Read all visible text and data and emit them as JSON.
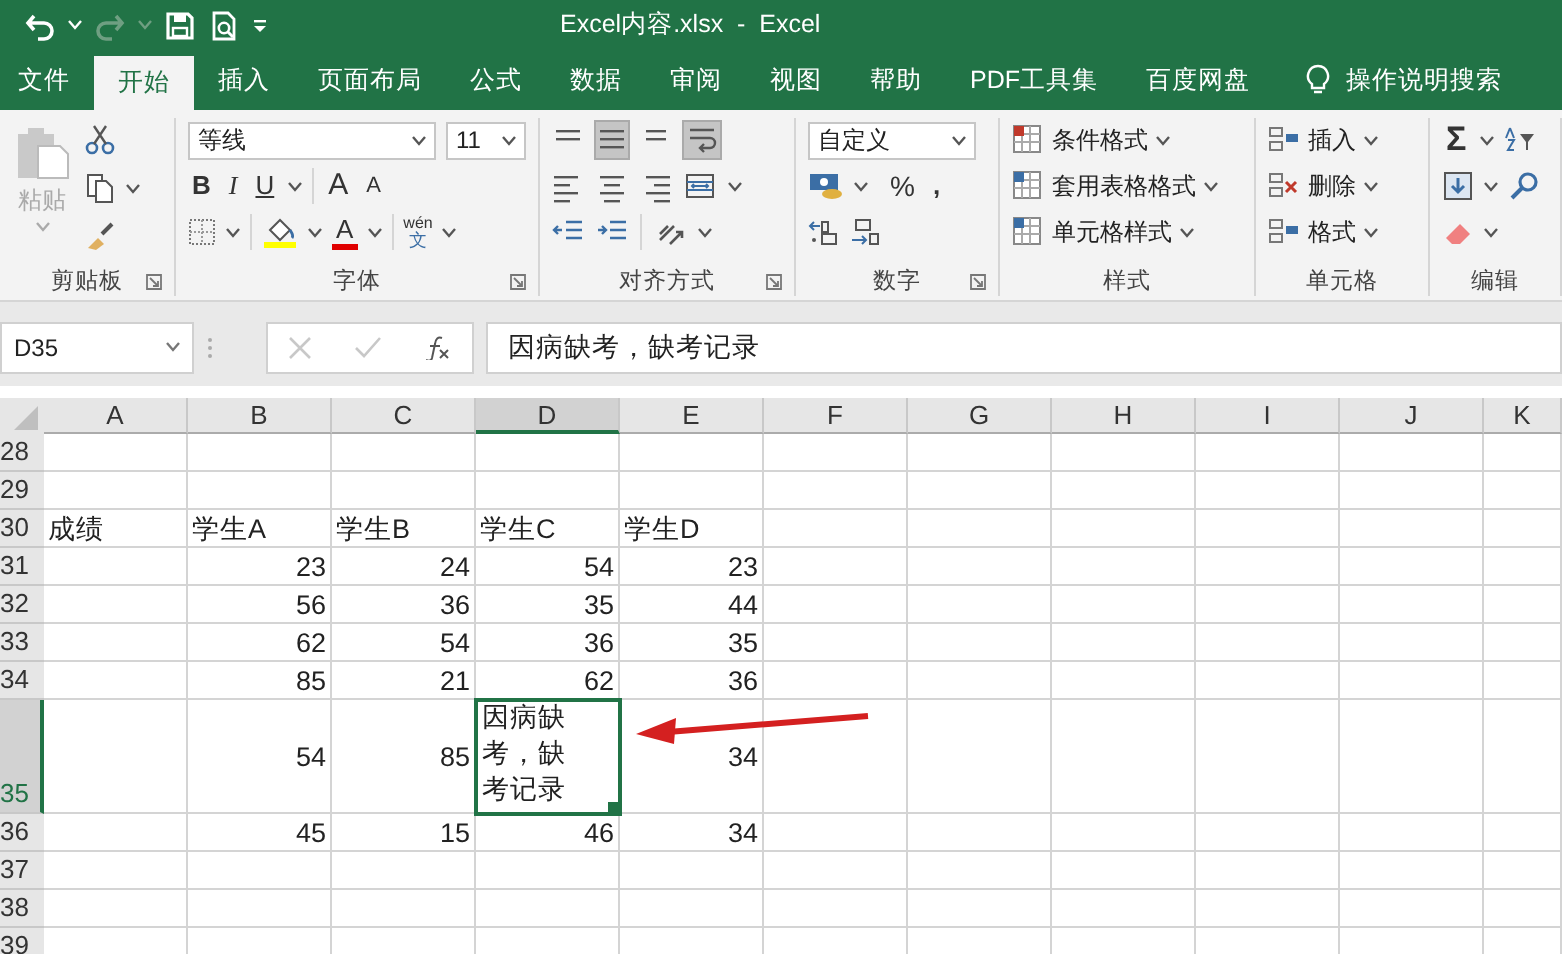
{
  "title_bar": {
    "title": "Excel内容.xlsx  -  Excel",
    "redo_disabled": true
  },
  "tabs": [
    {
      "label": "文件",
      "selected": false,
      "kind": "tab"
    },
    {
      "label": "开始",
      "selected": true,
      "kind": "tab"
    },
    {
      "label": "插入",
      "selected": false,
      "kind": "tab"
    },
    {
      "label": "页面布局",
      "selected": false,
      "kind": "tab"
    },
    {
      "label": "公式",
      "selected": false,
      "kind": "tab"
    },
    {
      "label": "数据",
      "selected": false,
      "kind": "tab"
    },
    {
      "label": "审阅",
      "selected": false,
      "kind": "tab"
    },
    {
      "label": "视图",
      "selected": false,
      "kind": "tab"
    },
    {
      "label": "帮助",
      "selected": false,
      "kind": "tab"
    },
    {
      "label": "PDF工具集",
      "selected": false,
      "kind": "tab"
    },
    {
      "label": "百度网盘",
      "selected": false,
      "kind": "tab"
    },
    {
      "label": "操作说明搜索",
      "selected": false,
      "kind": "search"
    }
  ],
  "ribbon": {
    "clipboard": {
      "paste_label": "粘贴",
      "paste_disabled": true,
      "group_label": "剪贴板"
    },
    "font": {
      "font_name": "等线",
      "font_size": "11",
      "bold": "B",
      "italic": "I",
      "underline": "U",
      "grow": "A",
      "shrink": "A",
      "font_color": "A",
      "phonetic_top": "wén",
      "phonetic_bottom": "文",
      "group_label": "字体"
    },
    "alignment": {
      "middle_align_on": true,
      "wrap_text_on": true,
      "group_label": "对齐方式"
    },
    "number": {
      "format": "自定义",
      "percent": "%",
      "comma": ",",
      "group_label": "数字"
    },
    "styles": {
      "items": [
        "条件格式",
        "套用表格格式",
        "单元格样式"
      ],
      "group_label": "样式"
    },
    "cells": {
      "items": [
        "插入",
        "删除",
        "格式"
      ],
      "group_label": "单元格"
    },
    "editing": {
      "sum": "Σ",
      "group_label": "编辑"
    }
  },
  "formula_bar": {
    "name_box": "D35",
    "content": "因病缺考，缺考记录"
  },
  "sheet": {
    "columns": [
      {
        "label": "A",
        "selected": false
      },
      {
        "label": "B",
        "selected": false
      },
      {
        "label": "C",
        "selected": false
      },
      {
        "label": "D",
        "selected": true
      },
      {
        "label": "E",
        "selected": false
      },
      {
        "label": "F",
        "selected": false
      },
      {
        "label": "G",
        "selected": false
      },
      {
        "label": "H",
        "selected": false
      },
      {
        "label": "I",
        "selected": false
      },
      {
        "label": "J",
        "selected": false
      },
      {
        "label": "K",
        "selected": false
      }
    ],
    "rows": [
      {
        "label": "28",
        "selected": false,
        "tall": false,
        "cells": []
      },
      {
        "label": "29",
        "selected": false,
        "tall": false,
        "cells": []
      },
      {
        "label": "30",
        "selected": false,
        "tall": false,
        "cells": [
          {
            "kind": "text",
            "text": "成绩",
            "active": false
          },
          {
            "kind": "text",
            "text": "学生A",
            "active": false
          },
          {
            "kind": "text",
            "text": "学生B",
            "active": false
          },
          {
            "kind": "text",
            "text": "学生C",
            "active": false
          },
          {
            "kind": "text",
            "text": "学生D",
            "active": false
          }
        ]
      },
      {
        "label": "31",
        "selected": false,
        "tall": false,
        "cells": [
          null,
          {
            "kind": "number",
            "text": "23",
            "active": false
          },
          {
            "kind": "number",
            "text": "24",
            "active": false
          },
          {
            "kind": "number",
            "text": "54",
            "active": false
          },
          {
            "kind": "number",
            "text": "23",
            "active": false
          }
        ]
      },
      {
        "label": "32",
        "selected": false,
        "tall": false,
        "cells": [
          null,
          {
            "kind": "number",
            "text": "56",
            "active": false
          },
          {
            "kind": "number",
            "text": "36",
            "active": false
          },
          {
            "kind": "number",
            "text": "35",
            "active": false
          },
          {
            "kind": "number",
            "text": "44",
            "active": false
          }
        ]
      },
      {
        "label": "33",
        "selected": false,
        "tall": false,
        "cells": [
          null,
          {
            "kind": "number",
            "text": "62",
            "active": false
          },
          {
            "kind": "number",
            "text": "54",
            "active": false
          },
          {
            "kind": "number",
            "text": "36",
            "active": false
          },
          {
            "kind": "number",
            "text": "35",
            "active": false
          }
        ]
      },
      {
        "label": "34",
        "selected": false,
        "tall": false,
        "cells": [
          null,
          {
            "kind": "number",
            "text": "85",
            "active": false
          },
          {
            "kind": "number",
            "text": "21",
            "active": false
          },
          {
            "kind": "number",
            "text": "62",
            "active": false
          },
          {
            "kind": "number",
            "text": "36",
            "active": false
          }
        ]
      },
      {
        "label": "35",
        "selected": true,
        "tall": true,
        "cells": [
          null,
          {
            "kind": "number",
            "text": "54",
            "active": false
          },
          {
            "kind": "number",
            "text": "85",
            "active": false
          },
          {
            "kind": "wrap",
            "text": "因病缺考，缺考记录",
            "active": true
          },
          {
            "kind": "number",
            "text": "34",
            "active": false
          }
        ]
      },
      {
        "label": "36",
        "selected": false,
        "tall": false,
        "cells": [
          null,
          {
            "kind": "number",
            "text": "45",
            "active": false
          },
          {
            "kind": "number",
            "text": "15",
            "active": false
          },
          {
            "kind": "number",
            "text": "46",
            "active": false
          },
          {
            "kind": "number",
            "text": "34",
            "active": false
          }
        ]
      },
      {
        "label": "37",
        "selected": false,
        "tall": false,
        "cells": []
      },
      {
        "label": "38",
        "selected": false,
        "tall": false,
        "cells": []
      },
      {
        "label": "39",
        "selected": false,
        "tall": false,
        "cells": []
      }
    ]
  }
}
